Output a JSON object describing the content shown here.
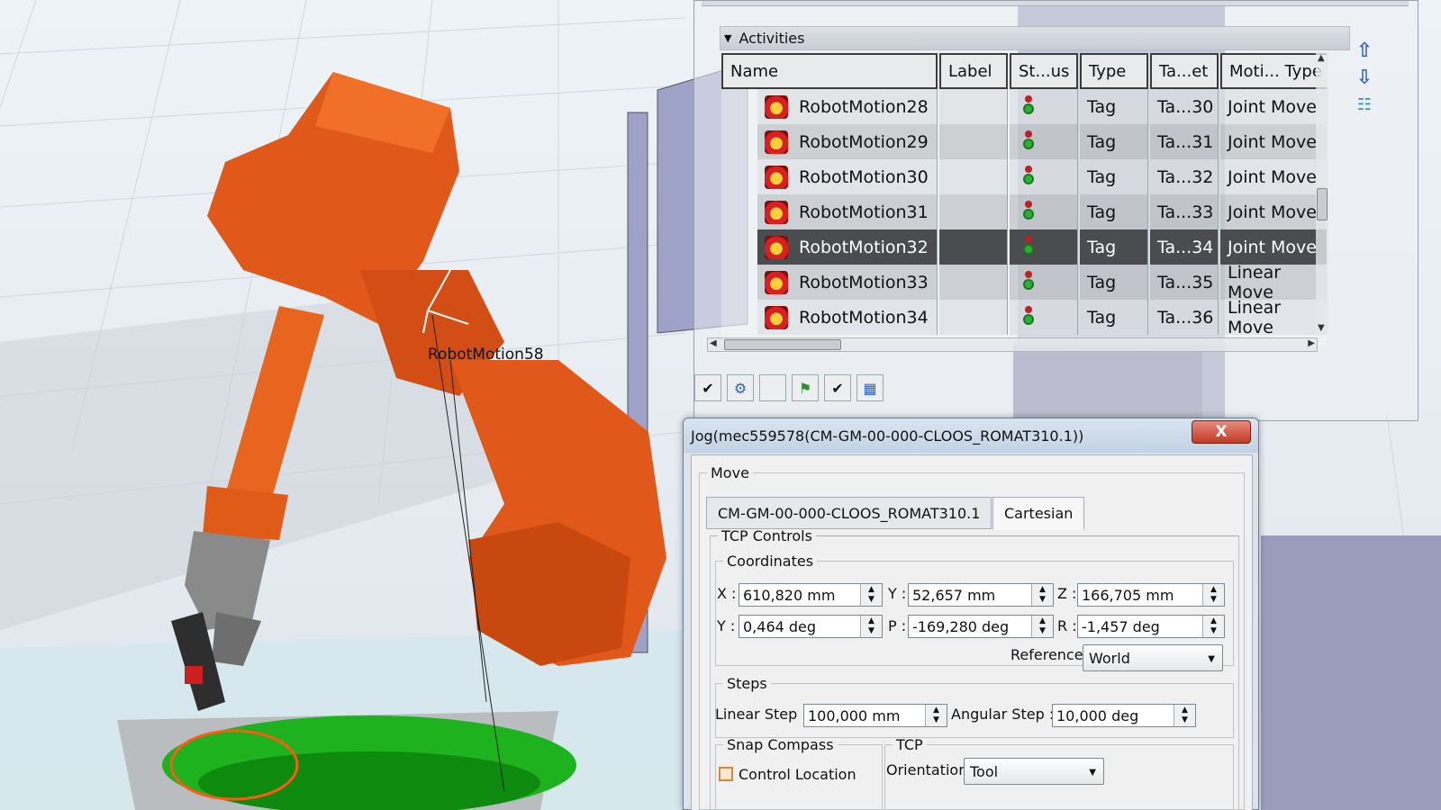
{
  "viewport": {
    "label": "RobotMotion58",
    "background": "#e9eef3",
    "robot_color": "#e8601a",
    "axes": {
      "x": "x",
      "y": "y",
      "z": "z"
    }
  },
  "activities": {
    "header": "Activities",
    "columns": [
      "Name",
      "Label",
      "St...us",
      "Type",
      "Ta...et",
      "Moti... Type"
    ],
    "rows": [
      {
        "name": "RobotMotion28",
        "label": "",
        "type": "Tag",
        "target": "Ta...30",
        "motion": "Joint Move",
        "selected": false
      },
      {
        "name": "RobotMotion29",
        "label": "",
        "type": "Tag",
        "target": "Ta...31",
        "motion": "Joint Move",
        "selected": false
      },
      {
        "name": "RobotMotion30",
        "label": "",
        "type": "Tag",
        "target": "Ta...32",
        "motion": "Joint Move",
        "selected": false
      },
      {
        "name": "RobotMotion31",
        "label": "",
        "type": "Tag",
        "target": "Ta...33",
        "motion": "Joint Move",
        "selected": false
      },
      {
        "name": "RobotMotion32",
        "label": "",
        "type": "Tag",
        "target": "Ta...34",
        "motion": "Joint Move",
        "selected": true
      },
      {
        "name": "RobotMotion33",
        "label": "",
        "type": "Tag",
        "target": "Ta...35",
        "motion": "Linear Move",
        "selected": false
      },
      {
        "name": "RobotMotion34",
        "label": "",
        "type": "Tag",
        "target": "Ta...36",
        "motion": "Linear Move",
        "selected": false
      }
    ],
    "side_tools": [
      "move-up-icon",
      "move-down-icon",
      "hierarchy-icon"
    ],
    "bottom_tools": [
      "check-icon",
      "robot-icon",
      "blank",
      "teach-icon",
      "check-icon",
      "film-icon"
    ]
  },
  "jog": {
    "title": "Jog(mec559578(CM-GM-00-000-CLOOS_ROMAT310.1))",
    "close": "X",
    "move_group": "Move",
    "tabs": [
      "CM-GM-00-000-CLOOS_ROMAT310.1",
      "Cartesian"
    ],
    "active_tab": 1,
    "tcp_controls": "TCP Controls",
    "coordinates": "Coordinates",
    "x_label": "X :",
    "x_value": "610,820 mm",
    "y_label": "Y :",
    "y_value": "52,657 mm",
    "z_label": "Z :",
    "z_value": "166,705 mm",
    "yaw_label": "Y :",
    "yaw_value": "0,464 deg",
    "pitch_label": "P :",
    "pitch_value": "-169,280 deg",
    "roll_label": "R :",
    "roll_value": "-1,457 deg",
    "reference_label": "Reference",
    "reference_value": "World",
    "steps": "Steps",
    "linear_step_label": "Linear Step :",
    "linear_step_value": "100,000 mm",
    "angular_step_label": "Angular Step :",
    "angular_step_value": "10,000 deg",
    "snap_compass": "Snap Compass",
    "control_location": "Control Location",
    "tcp": "TCP",
    "orientation_label": "Orientation",
    "orientation_value": "Tool"
  }
}
